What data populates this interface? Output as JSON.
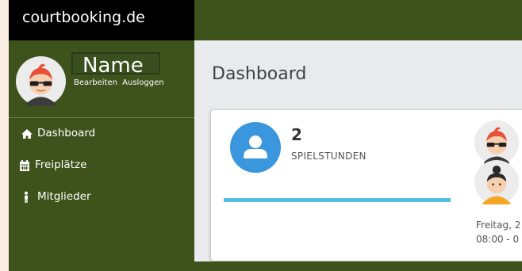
{
  "brand": {
    "name": "courtbooking.de"
  },
  "user": {
    "name": "Name",
    "edit_label": "Bearbeiten",
    "logout_label": "Ausloggen"
  },
  "nav": {
    "items": [
      {
        "label": "Dashboard",
        "icon": "home-icon"
      },
      {
        "label": "Freiplätze",
        "icon": "calendar-icon"
      },
      {
        "label": "Mitglieder",
        "icon": "person-icon"
      }
    ]
  },
  "page": {
    "title": "Dashboard"
  },
  "card": {
    "stat_value": "2",
    "stat_label": "SPIELSTUNDEN",
    "stat_icon": "user-icon",
    "progress": 1.0,
    "booking_date": "Freitag, 2",
    "booking_time": "08:00 - 0"
  },
  "colors": {
    "sidebar": "#3e521c",
    "brand_bar": "#000000",
    "accent_blue": "#3a96dd",
    "progress": "#55bfe3",
    "content_bg": "#e8eaed"
  }
}
